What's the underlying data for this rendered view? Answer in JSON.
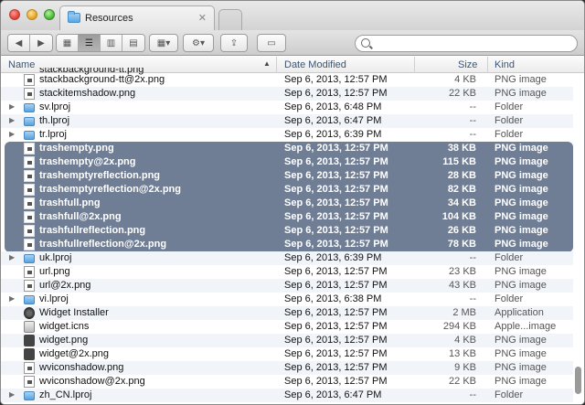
{
  "window": {
    "tab_title": "Resources"
  },
  "columns": {
    "name": "Name",
    "date": "Date Modified",
    "size": "Size",
    "kind": "Kind"
  },
  "partial_row": {
    "name": "stackbackground-tt.png"
  },
  "rows": [
    {
      "type": "file",
      "disclosure": false,
      "name": "stackbackground-tt@2x.png",
      "date": "Sep 6, 2013, 12:57 PM",
      "size": "4 KB",
      "kind": "PNG image",
      "selected": false
    },
    {
      "type": "file",
      "disclosure": false,
      "name": "stackitemshadow.png",
      "date": "Sep 6, 2013, 12:57 PM",
      "size": "22 KB",
      "kind": "PNG image",
      "selected": false
    },
    {
      "type": "folder",
      "disclosure": true,
      "name": "sv.lproj",
      "date": "Sep 6, 2013, 6:48 PM",
      "size": "--",
      "kind": "Folder",
      "selected": false
    },
    {
      "type": "folder",
      "disclosure": true,
      "name": "th.lproj",
      "date": "Sep 6, 2013, 6:47 PM",
      "size": "--",
      "kind": "Folder",
      "selected": false
    },
    {
      "type": "folder",
      "disclosure": true,
      "name": "tr.lproj",
      "date": "Sep 6, 2013, 6:39 PM",
      "size": "--",
      "kind": "Folder",
      "selected": false
    },
    {
      "type": "file",
      "disclosure": false,
      "name": "trashempty.png",
      "date": "Sep 6, 2013, 12:57 PM",
      "size": "38 KB",
      "kind": "PNG image",
      "selected": true
    },
    {
      "type": "file",
      "disclosure": false,
      "name": "trashempty@2x.png",
      "date": "Sep 6, 2013, 12:57 PM",
      "size": "115 KB",
      "kind": "PNG image",
      "selected": true
    },
    {
      "type": "file",
      "disclosure": false,
      "name": "trashemptyreflection.png",
      "date": "Sep 6, 2013, 12:57 PM",
      "size": "28 KB",
      "kind": "PNG image",
      "selected": true
    },
    {
      "type": "file",
      "disclosure": false,
      "name": "trashemptyreflection@2x.png",
      "date": "Sep 6, 2013, 12:57 PM",
      "size": "82 KB",
      "kind": "PNG image",
      "selected": true
    },
    {
      "type": "file",
      "disclosure": false,
      "name": "trashfull.png",
      "date": "Sep 6, 2013, 12:57 PM",
      "size": "34 KB",
      "kind": "PNG image",
      "selected": true
    },
    {
      "type": "file",
      "disclosure": false,
      "name": "trashfull@2x.png",
      "date": "Sep 6, 2013, 12:57 PM",
      "size": "104 KB",
      "kind": "PNG image",
      "selected": true
    },
    {
      "type": "file",
      "disclosure": false,
      "name": "trashfullreflection.png",
      "date": "Sep 6, 2013, 12:57 PM",
      "size": "26 KB",
      "kind": "PNG image",
      "selected": true
    },
    {
      "type": "file",
      "disclosure": false,
      "name": "trashfullreflection@2x.png",
      "date": "Sep 6, 2013, 12:57 PM",
      "size": "78 KB",
      "kind": "PNG image",
      "selected": true
    },
    {
      "type": "folder",
      "disclosure": true,
      "name": "uk.lproj",
      "date": "Sep 6, 2013, 6:39 PM",
      "size": "--",
      "kind": "Folder",
      "selected": false
    },
    {
      "type": "file",
      "disclosure": false,
      "name": "url.png",
      "date": "Sep 6, 2013, 12:57 PM",
      "size": "23 KB",
      "kind": "PNG image",
      "selected": false
    },
    {
      "type": "file",
      "disclosure": false,
      "name": "url@2x.png",
      "date": "Sep 6, 2013, 12:57 PM",
      "size": "43 KB",
      "kind": "PNG image",
      "selected": false
    },
    {
      "type": "folder",
      "disclosure": true,
      "name": "vi.lproj",
      "date": "Sep 6, 2013, 6:38 PM",
      "size": "--",
      "kind": "Folder",
      "selected": false
    },
    {
      "type": "app",
      "disclosure": false,
      "name": "Widget Installer",
      "date": "Sep 6, 2013, 12:57 PM",
      "size": "2 MB",
      "kind": "Application",
      "selected": false
    },
    {
      "type": "icns",
      "disclosure": false,
      "name": "widget.icns",
      "date": "Sep 6, 2013, 12:57 PM",
      "size": "294 KB",
      "kind": "Apple...image",
      "selected": false
    },
    {
      "type": "widget",
      "disclosure": false,
      "name": "widget.png",
      "date": "Sep 6, 2013, 12:57 PM",
      "size": "4 KB",
      "kind": "PNG image",
      "selected": false
    },
    {
      "type": "widget",
      "disclosure": false,
      "name": "widget@2x.png",
      "date": "Sep 6, 2013, 12:57 PM",
      "size": "13 KB",
      "kind": "PNG image",
      "selected": false
    },
    {
      "type": "file",
      "disclosure": false,
      "name": "wviconshadow.png",
      "date": "Sep 6, 2013, 12:57 PM",
      "size": "9 KB",
      "kind": "PNG image",
      "selected": false
    },
    {
      "type": "file",
      "disclosure": false,
      "name": "wviconshadow@2x.png",
      "date": "Sep 6, 2013, 12:57 PM",
      "size": "22 KB",
      "kind": "PNG image",
      "selected": false
    },
    {
      "type": "folder",
      "disclosure": true,
      "name": "zh_CN.lproj",
      "date": "Sep 6, 2013, 6:47 PM",
      "size": "--",
      "kind": "Folder",
      "selected": false
    }
  ],
  "colors": {
    "selection": "#6f7e95",
    "header_text": "#3b5578"
  }
}
